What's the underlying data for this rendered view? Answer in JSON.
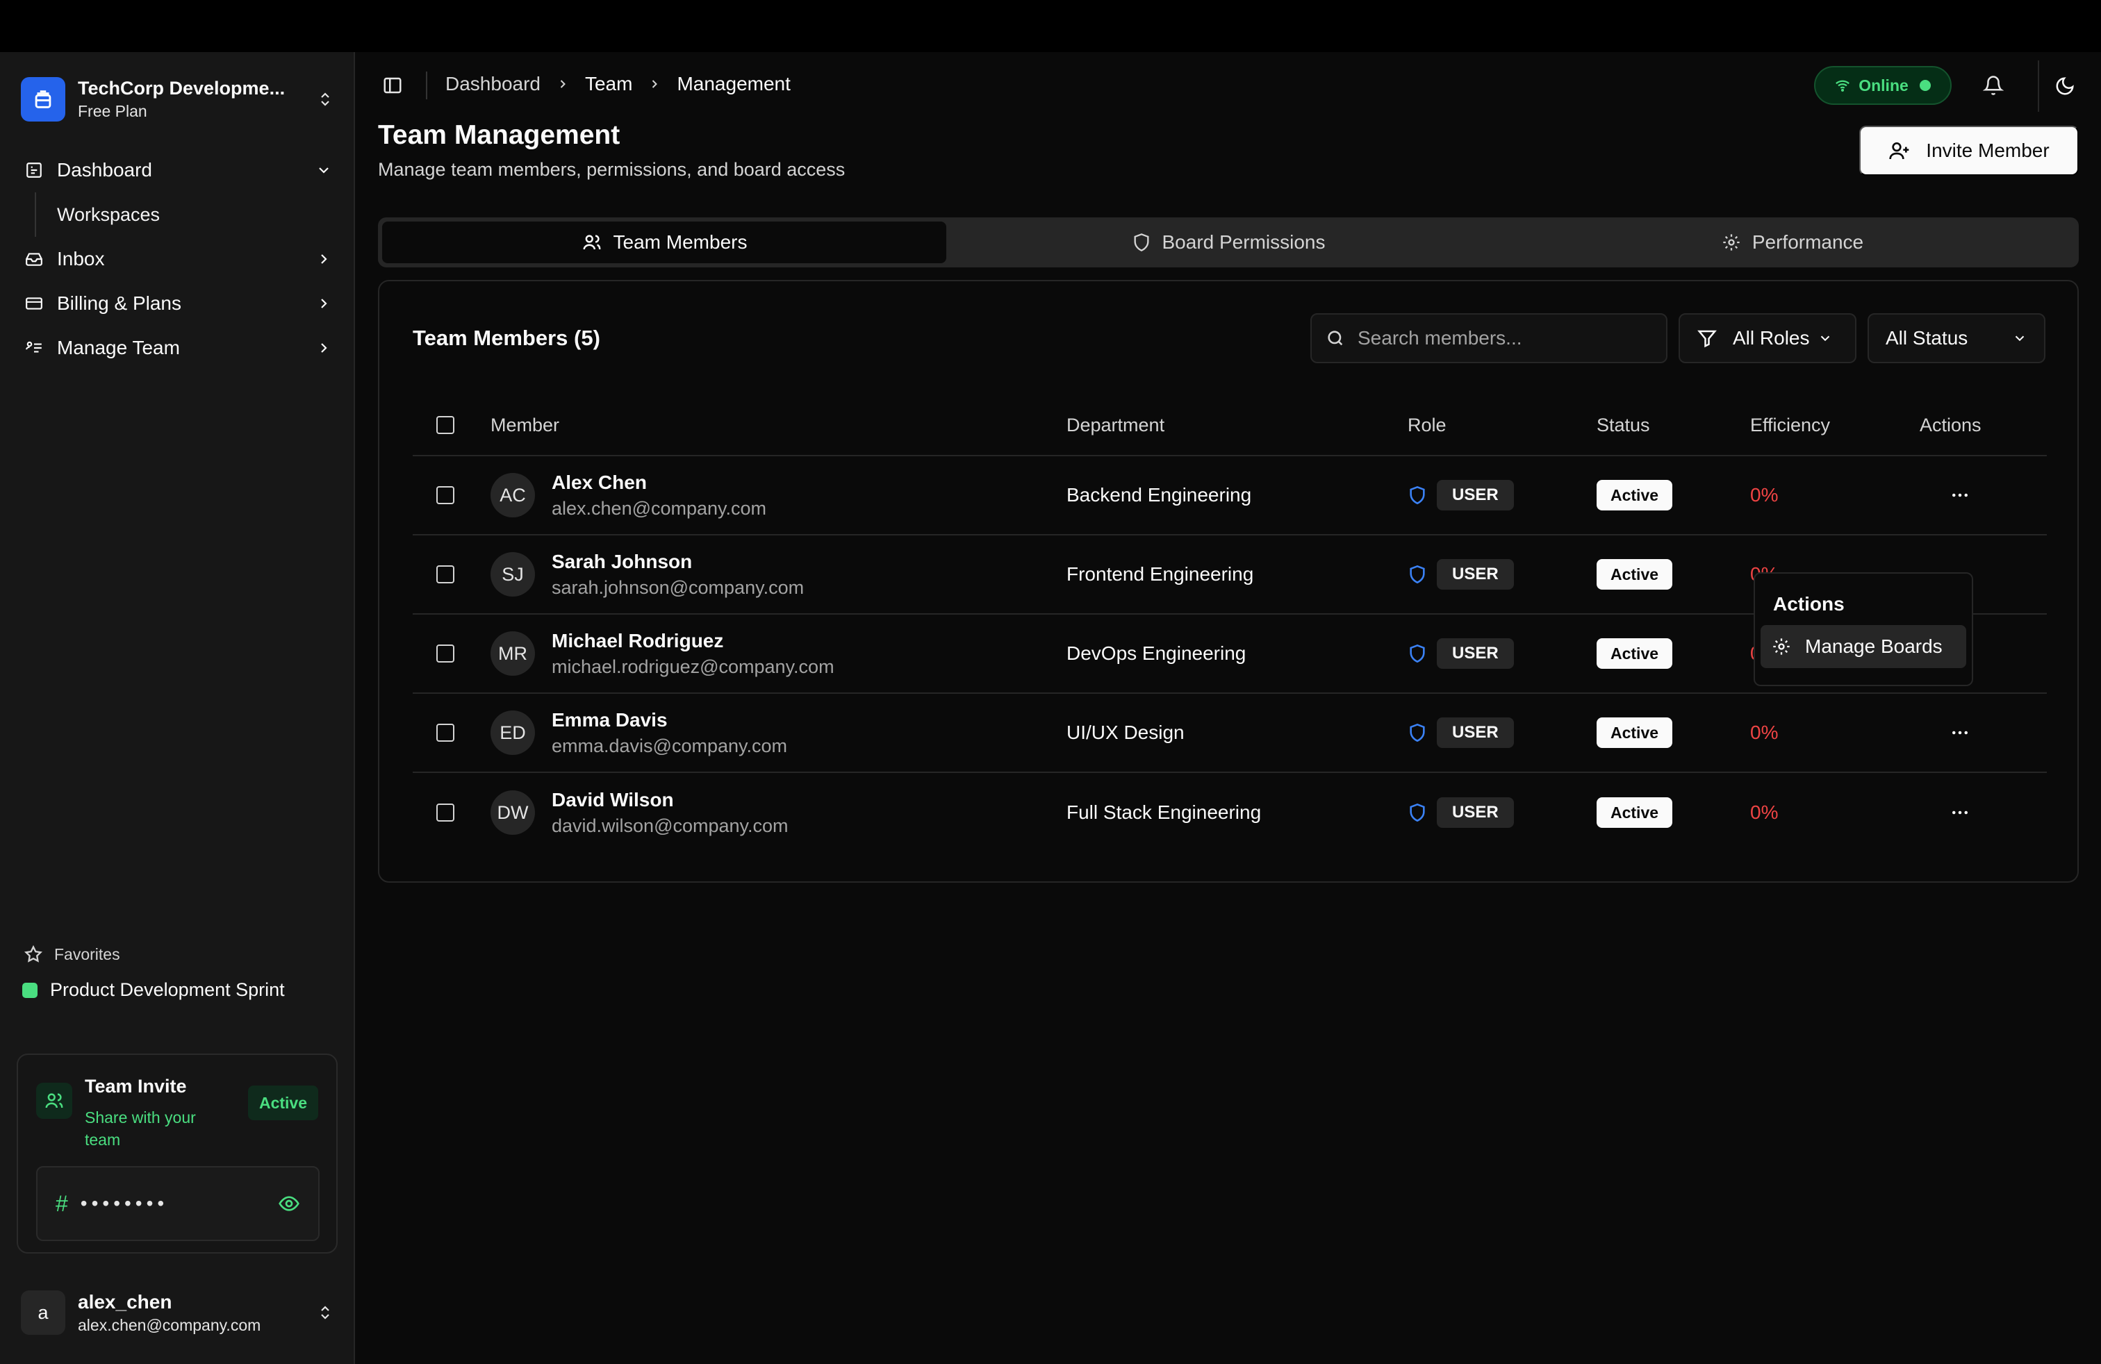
{
  "workspace": {
    "name": "TechCorp Developme...",
    "plan": "Free Plan"
  },
  "sidebar": {
    "items": [
      {
        "label": "Dashboard",
        "icon": "dashboard-icon",
        "expanded": true
      },
      {
        "label": "Workspaces",
        "sub": true
      },
      {
        "label": "Inbox",
        "icon": "inbox-icon"
      },
      {
        "label": "Billing & Plans",
        "icon": "credit-card-icon"
      },
      {
        "label": "Manage Team",
        "icon": "team-settings-icon"
      }
    ],
    "favorites_label": "Favorites",
    "favorites": [
      {
        "label": "Product Development Sprint",
        "color": "#4ade80"
      }
    ],
    "invite_card": {
      "title": "Team Invite",
      "subtitle": "Share with your team",
      "badge": "Active",
      "code_mask": "••••••••"
    },
    "user": {
      "initial": "a",
      "name": "alex_chen",
      "email": "alex.chen@company.com"
    }
  },
  "header": {
    "breadcrumb": [
      "Dashboard",
      "Team",
      "Management"
    ],
    "status": "Online"
  },
  "page": {
    "title": "Team Management",
    "subtitle": "Manage team members, permissions, and board access",
    "invite_button": "Invite Member"
  },
  "tabs": [
    {
      "label": "Team Members",
      "active": true
    },
    {
      "label": "Board Permissions"
    },
    {
      "label": "Performance"
    }
  ],
  "members_card": {
    "title": "Team Members (5)",
    "search_placeholder": "Search members...",
    "role_filter": "All Roles",
    "status_filter": "All Status",
    "columns": [
      "Member",
      "Department",
      "Role",
      "Status",
      "Efficiency",
      "Actions"
    ],
    "rows": [
      {
        "initials": "AC",
        "name": "Alex Chen",
        "email": "alex.chen@company.com",
        "department": "Backend Engineering",
        "role": "USER",
        "status": "Active",
        "efficiency": "0%"
      },
      {
        "initials": "SJ",
        "name": "Sarah Johnson",
        "email": "sarah.johnson@company.com",
        "department": "Frontend Engineering",
        "role": "USER",
        "status": "Active",
        "efficiency": "0%"
      },
      {
        "initials": "MR",
        "name": "Michael Rodriguez",
        "email": "michael.rodriguez@company.com",
        "department": "DevOps Engineering",
        "role": "USER",
        "status": "Active",
        "efficiency": "0%"
      },
      {
        "initials": "ED",
        "name": "Emma Davis",
        "email": "emma.davis@company.com",
        "department": "UI/UX Design",
        "role": "USER",
        "status": "Active",
        "efficiency": "0%"
      },
      {
        "initials": "DW",
        "name": "David Wilson",
        "email": "david.wilson@company.com",
        "department": "Full Stack Engineering",
        "role": "USER",
        "status": "Active",
        "efficiency": "0%"
      }
    ]
  },
  "actions_menu": {
    "heading": "Actions",
    "items": [
      "Manage Boards"
    ]
  },
  "colors": {
    "accent": "#2563eb",
    "online": "#4ade80",
    "efficiency": "#ef4444",
    "role_shield": "#3b82f6"
  }
}
